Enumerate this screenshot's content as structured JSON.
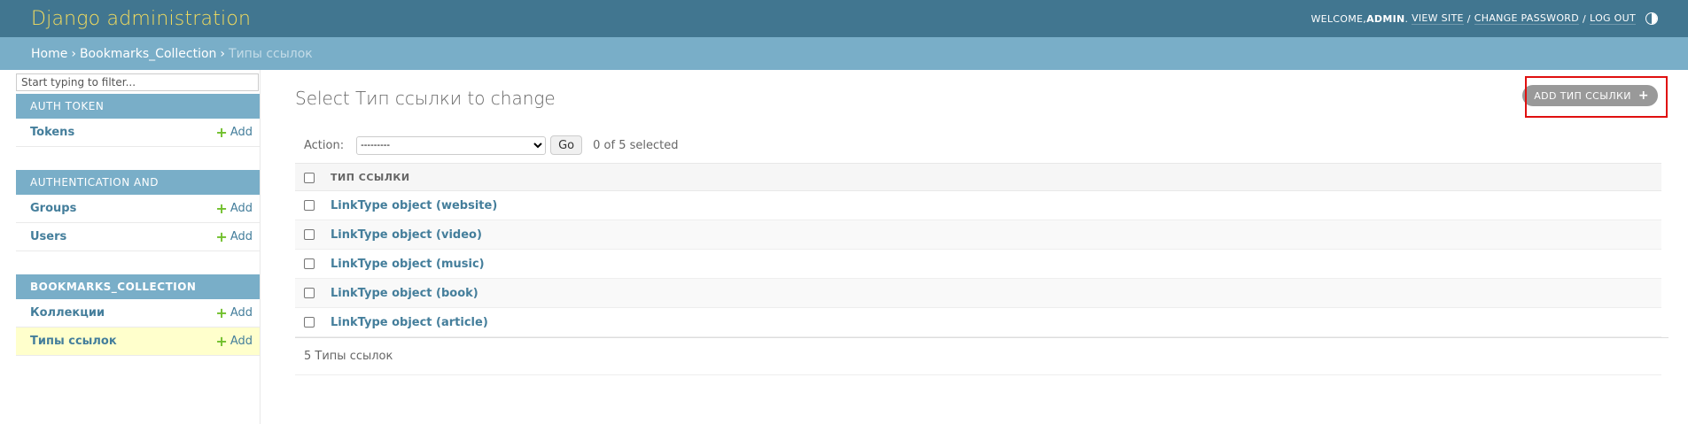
{
  "header": {
    "brand": "Django administration",
    "welcome": "WELCOME, ",
    "username": "ADMIN",
    "view_site": "VIEW SITE",
    "change_password": "CHANGE PASSWORD",
    "log_out": "LOG OUT",
    "sep": "/",
    "period": ".",
    "theme_icon": "theme-toggle-icon"
  },
  "breadcrumbs": {
    "home": "Home",
    "app": "Bookmarks_Collection",
    "current": "Типы ссылок",
    "sep": "›"
  },
  "sidebar": {
    "filter_placeholder": "Start typing to filter...",
    "add_label": "Add",
    "modules": [
      {
        "caption": "Auth Token",
        "models": [
          {
            "name": "Tokens"
          }
        ]
      },
      {
        "caption": "Authentication and Authorization",
        "models": [
          {
            "name": "Groups"
          },
          {
            "name": "Users"
          }
        ]
      },
      {
        "caption": "Bookmarks_Collection",
        "models": [
          {
            "name": "Коллекции"
          },
          {
            "name": "Типы ссылок"
          }
        ]
      }
    ]
  },
  "content": {
    "title": "Select Тип ссылки to change",
    "add_button": "Add Тип ссылки",
    "action_label": "Action:",
    "action_selected": "---------",
    "go_label": "Go",
    "counter": "0 of 5 selected",
    "column_header": "Тип ссылки",
    "rows": [
      "LinkType object (website)",
      "LinkType object (video)",
      "LinkType object (music)",
      "LinkType object (book)",
      "LinkType object (article)"
    ],
    "paginator": "5 Типы ссылок"
  },
  "colors": {
    "header": "#417690",
    "breadcrumbs": "#79aec8",
    "brand": "#f5dd5d",
    "link": "#447e9b",
    "add_plus": "#70bf2b",
    "current_row": "#ffffcc",
    "highlight": "#e01010"
  }
}
